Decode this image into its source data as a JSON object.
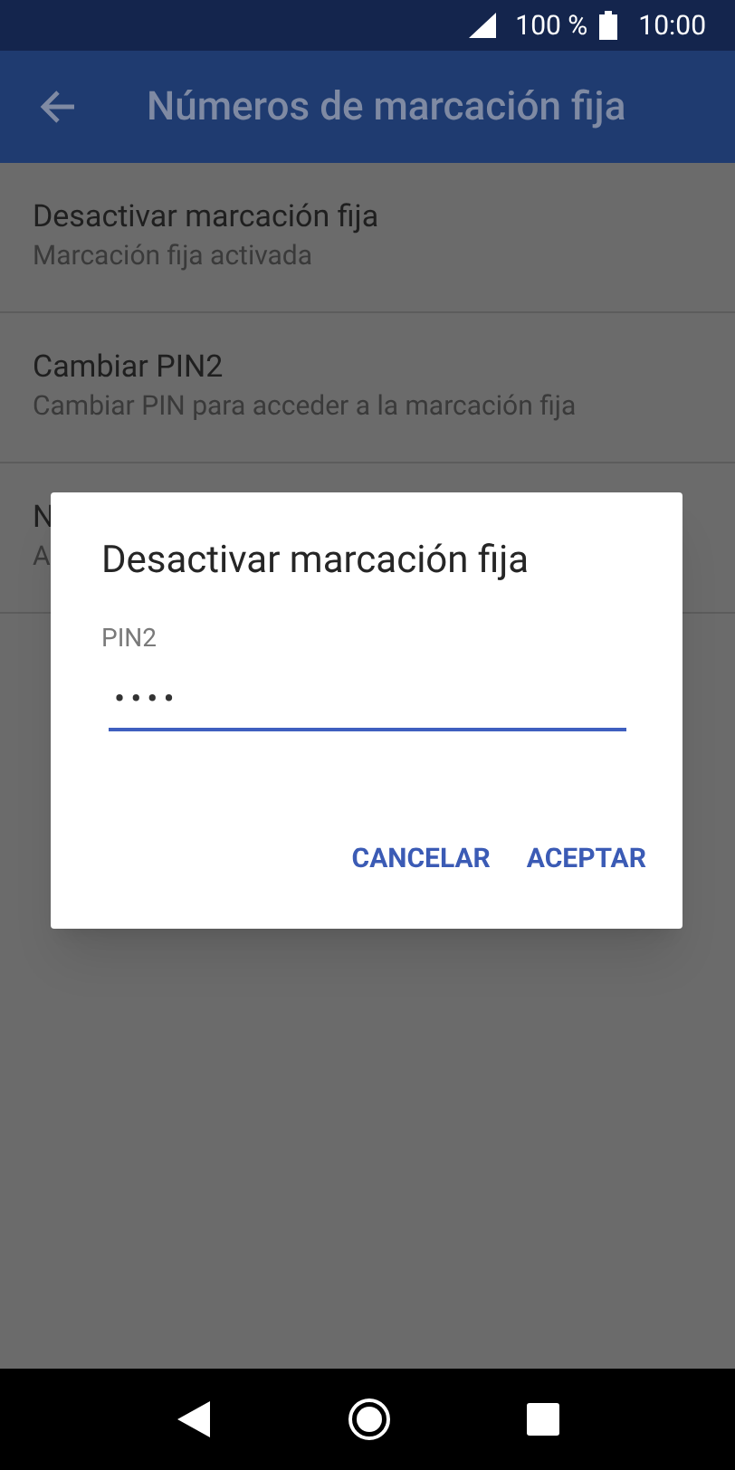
{
  "status_bar": {
    "battery": "100 %",
    "time": "10:00"
  },
  "app_bar": {
    "title": "Números de marcación fija"
  },
  "settings_items": [
    {
      "title": "Desactivar marcación fija",
      "subtitle": "Marcación fija activada"
    },
    {
      "title": "Cambiar PIN2",
      "subtitle": "Cambiar PIN para acceder a la marcación fija"
    },
    {
      "title": "N",
      "subtitle": "A"
    }
  ],
  "dialog": {
    "title": "Desactivar marcación fija",
    "field": {
      "label": "PIN2",
      "value": "••••"
    },
    "buttons": [
      "CANCELAR",
      "ACEPTAR"
    ]
  }
}
